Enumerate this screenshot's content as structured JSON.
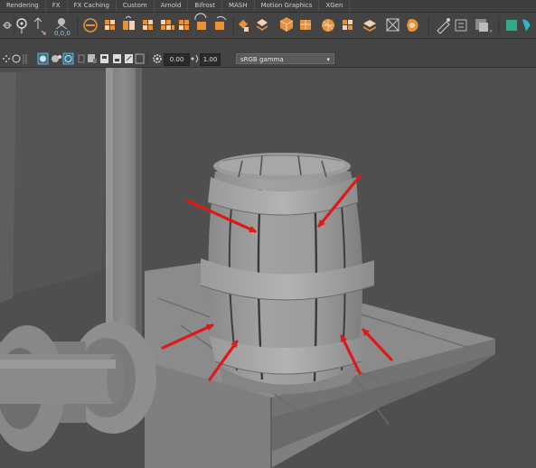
{
  "shelf_tabs": [
    "Rendering",
    "FX",
    "FX Caching",
    "Custom",
    "Arnold",
    "Bifrost",
    "MASH",
    "Motion Graphics",
    "XGen"
  ],
  "shelf_icon_readout": "0,0,0",
  "viewport_toolbar": {
    "exposure_value": "0.00",
    "gamma_value": "1.00",
    "color_space": "sRGB gamma"
  },
  "icons": {
    "shelf": [
      "curve-cv-icon",
      "cluster-icon",
      "locator-icon",
      "polygon-sphere-icon",
      "polygon-cube-icon",
      "group-icon",
      "uv-icon",
      "bend-icon",
      "twist-icon",
      "lattice-icon",
      "rotate-icon",
      "wrap-icon",
      "nurbs-icon",
      "bevel-icon",
      "cube-icon",
      "sphere-icon",
      "sculpt-icon",
      "plane-icon",
      "soft-mod-icon",
      "mesh-icon",
      "pencil-icon",
      "bracket-icon",
      "square-icon",
      "ik-icon"
    ],
    "toolbar": [
      "grid-icon",
      "camera-icon",
      "isolate-icon",
      "wireframe-icon",
      "shaded-icon",
      "texture-icon",
      "light-icon",
      "shadow-icon",
      "xray-icon",
      "ao-icon",
      "exposure-icon",
      "gamma-icon"
    ]
  },
  "colors": {
    "ui_dark": "#444444",
    "viewport_bg": "#4e4e4e",
    "barrel_gray": "#9a9a9a",
    "annotation_arrow": "#e01818",
    "icon_accent": "#e8913a"
  }
}
